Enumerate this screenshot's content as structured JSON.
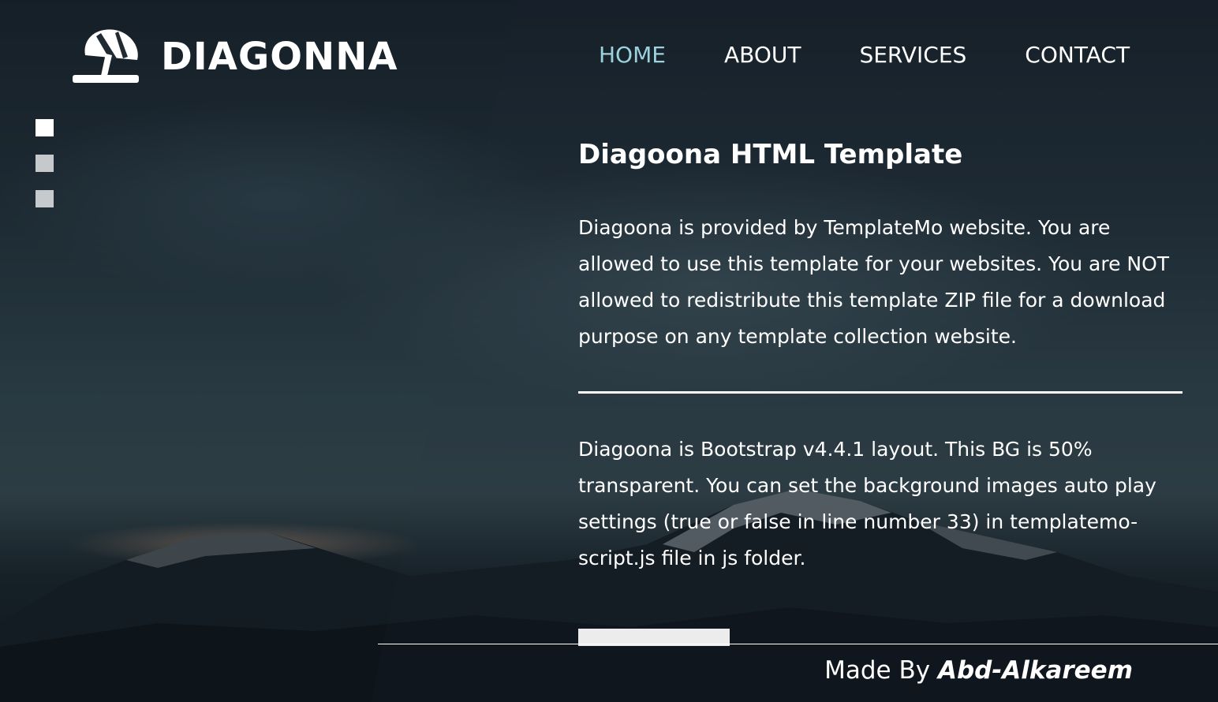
{
  "brand": {
    "name": "DIAGONNA",
    "logo_icon": "beach-umbrella-icon"
  },
  "nav": {
    "items": [
      {
        "label": "HOME",
        "active": true
      },
      {
        "label": "ABOUT",
        "active": false
      },
      {
        "label": "SERVICES",
        "active": false
      },
      {
        "label": "CONTACT",
        "active": false
      }
    ]
  },
  "slides": {
    "count": 3,
    "active_index": 0
  },
  "main": {
    "title": "Diagoona HTML Template",
    "paragraph1": "Diagoona is provided by TemplateMo website. You are allowed to use this template for your websites. You are NOT allowed to redistribute this template ZIP file for a download purpose on any template collection website.",
    "paragraph2": "Diagoona is Bootstrap v4.4.1 layout. This BG is 50% transparent. You can set the background images auto play settings (true or false in line number 33) in templatemo-script.js file in js folder."
  },
  "footer": {
    "prefix": "Made By ",
    "author": "Abd-Alkareem"
  },
  "colors": {
    "nav_active": "#9cd2dd",
    "text": "#ffffff",
    "button": "#ececec"
  }
}
